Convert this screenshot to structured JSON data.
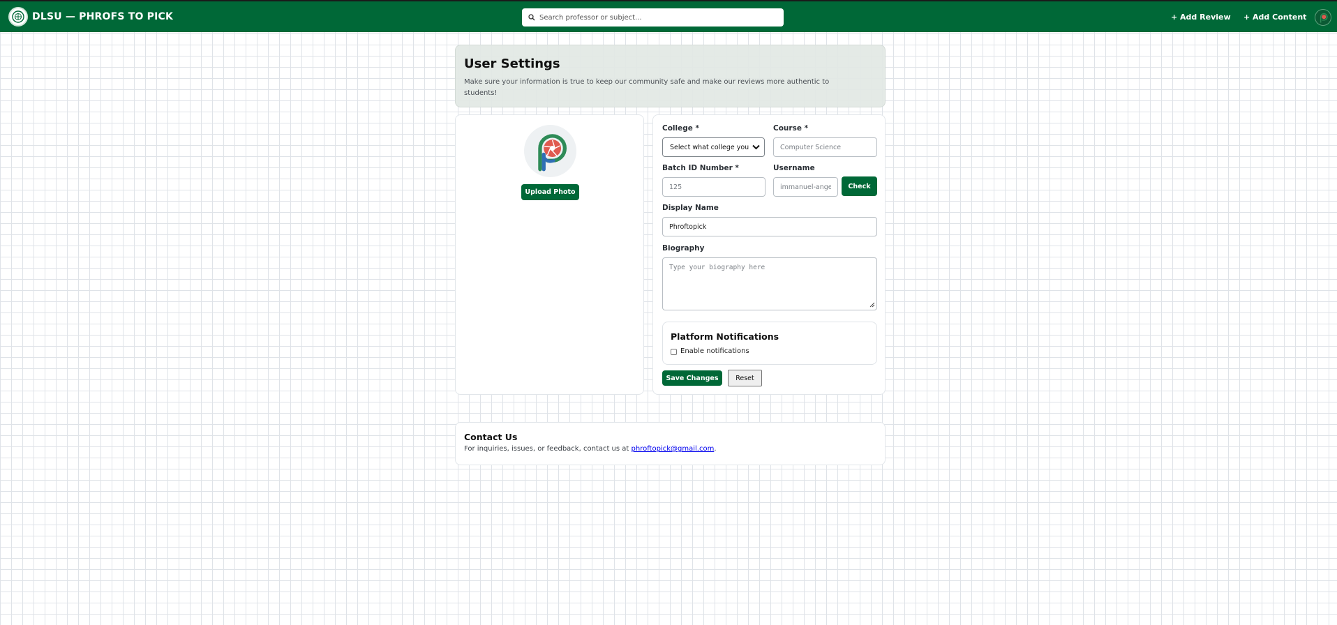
{
  "topbar": {
    "brand_title": "DLSU — PHROFS TO PICK",
    "search_placeholder": "Search professor or subject...",
    "add_review": "+ Add Review",
    "add_content": "+ Add Content"
  },
  "header": {
    "title": "User Settings",
    "subtitle": "Make sure your information is true to keep our community safe and make our reviews more authentic to students!"
  },
  "photo": {
    "upload_label": "Upload Photo"
  },
  "form": {
    "college_label": "College *",
    "college_selected": "Select what college you are",
    "course_label": "Course *",
    "course_placeholder": "Computer Science",
    "batch_label": "Batch ID Number *",
    "batch_placeholder": "125",
    "username_label": "Username",
    "username_placeholder": "immanuel-angelo",
    "check_label": "Check",
    "display_name_label": "Display Name",
    "display_name_value": "Phroftopick",
    "biography_label": "Biography",
    "biography_placeholder": "Type your biography here",
    "notifications_title": "Platform Notifications",
    "notifications_label": "Enable notifications",
    "notifications_enabled": false,
    "save_label": "Save Changes",
    "reset_label": "Reset"
  },
  "contact": {
    "title": "Contact Us",
    "text_before": "For inquiries, issues, or feedback, contact us at ",
    "email": "phroftopick@gmail.com",
    "text_after": "."
  },
  "colors": {
    "primary_green": "#006837",
    "logo_red": "#e05a4f",
    "logo_green": "#2e8b57",
    "logo_blue": "#2f6fb5"
  }
}
